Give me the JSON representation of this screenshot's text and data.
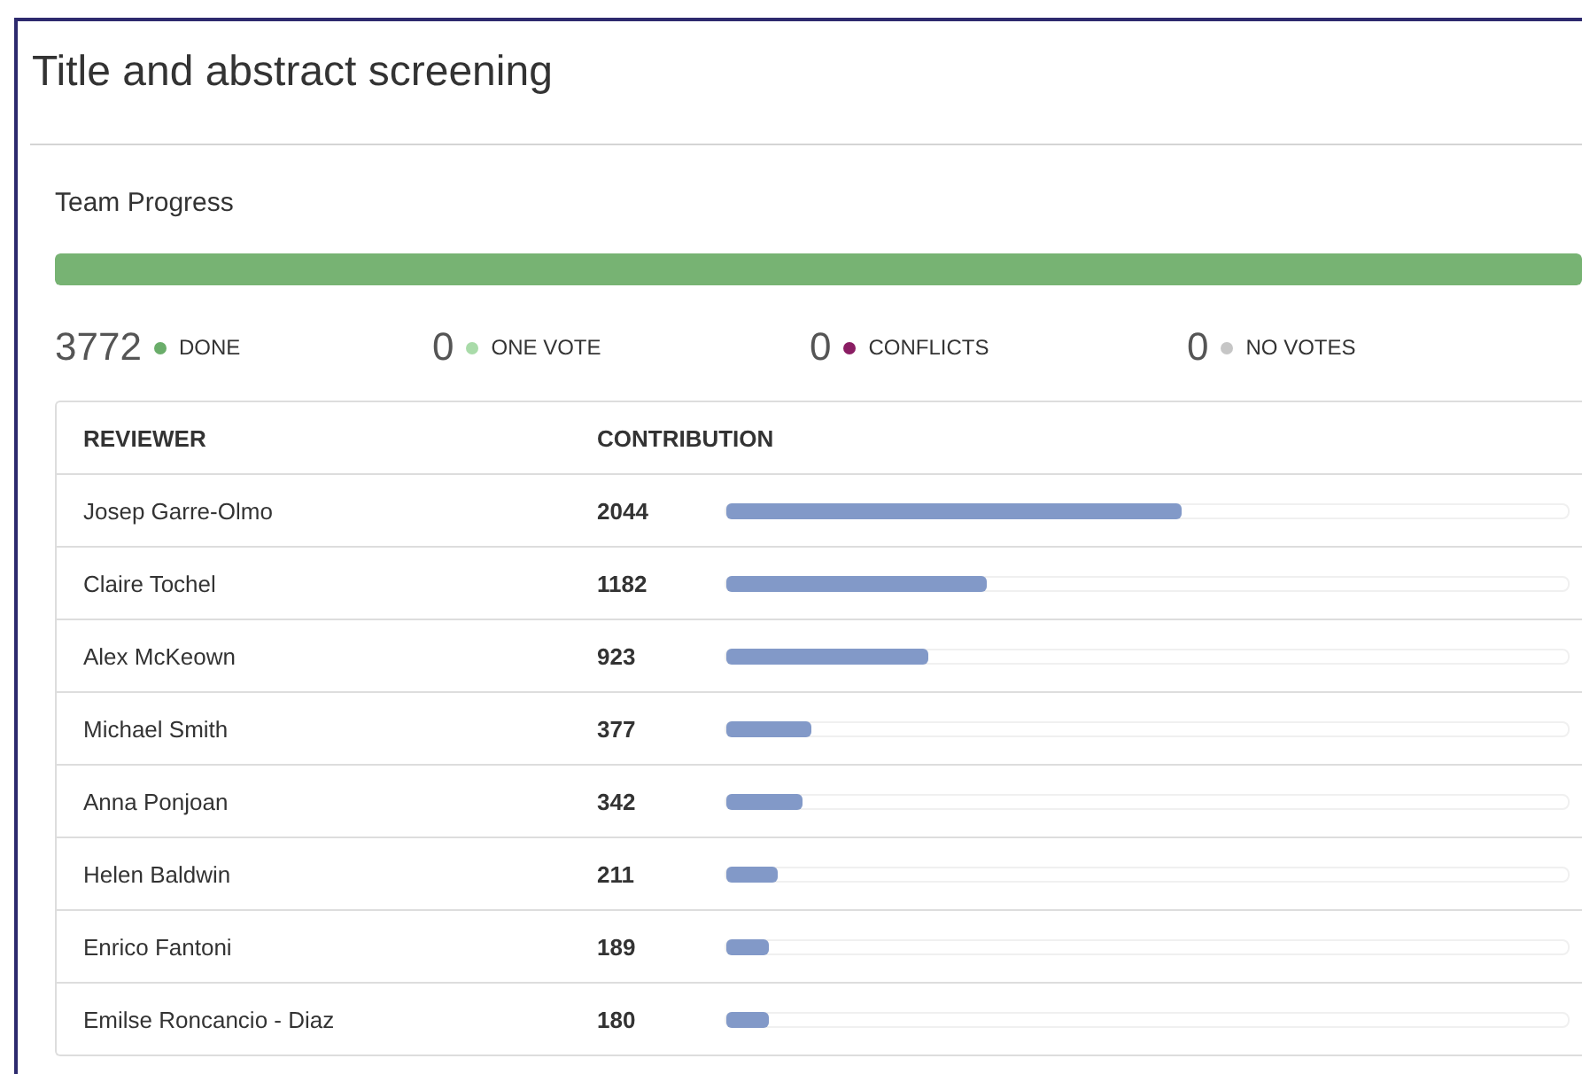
{
  "title": "Title and abstract screening",
  "team_progress": {
    "label": "Team Progress",
    "level": 1
  },
  "stats": [
    {
      "count": "3772",
      "label": "DONE",
      "color": "#6aad6a"
    },
    {
      "count": "0",
      "label": "ONE VOTE",
      "color": "#a9dba9"
    },
    {
      "count": "0",
      "label": "CONFLICTS",
      "color": "#8a1d63"
    },
    {
      "count": "0",
      "label": "NO VOTES",
      "color": "#c6c6c6"
    }
  ],
  "table": {
    "columns": [
      "REVIEWER",
      "CONTRIBUTION"
    ],
    "rows": [
      {
        "reviewer": "Josep Garre-Olmo",
        "count": "2044",
        "level": 0.54
      },
      {
        "reviewer": "Claire Tochel",
        "count": "1182",
        "level": 0.31
      },
      {
        "reviewer": "Alex McKeown",
        "count": "923",
        "level": 0.24
      },
      {
        "reviewer": "Michael Smith",
        "count": "377",
        "level": 0.1
      },
      {
        "reviewer": "Anna Ponjoan",
        "count": "342",
        "level": 0.09
      },
      {
        "reviewer": "Helen Baldwin",
        "count": "211",
        "level": 0.06
      },
      {
        "reviewer": "Enrico Fantoni",
        "count": "189",
        "level": 0.05
      },
      {
        "reviewer": "Emilse Roncancio - Diaz",
        "count": "180",
        "level": 0.05
      }
    ]
  }
}
